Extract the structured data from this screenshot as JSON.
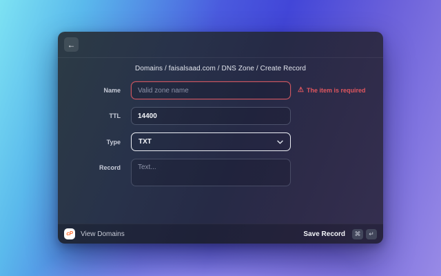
{
  "colors": {
    "error_red": "#e0565e",
    "cpanel_orange": "#ff6c2c",
    "focus_border": "#eef0f6",
    "background_top_left": "#7de2f3",
    "background_right": "#4246d8",
    "background_bottom": "#988ae6"
  },
  "header": {
    "back_icon": "←"
  },
  "breadcrumb": {
    "text": "Domains / faisalsaad.com / DNS Zone / Create Record"
  },
  "form": {
    "name": {
      "label": "Name",
      "value": "",
      "placeholder": "Valid zone name",
      "warning_icon": "⚠",
      "error": "The item is required"
    },
    "ttl": {
      "label": "TTL",
      "value": "14400"
    },
    "type": {
      "label": "Type",
      "value": "TXT"
    },
    "record": {
      "label": "Record",
      "value": "",
      "placeholder": "Text..."
    }
  },
  "footer": {
    "logo_text": "cP",
    "view_domains": "View Domains",
    "save_record": "Save Record",
    "shortcut_keys": [
      "⌘",
      "↵"
    ]
  }
}
